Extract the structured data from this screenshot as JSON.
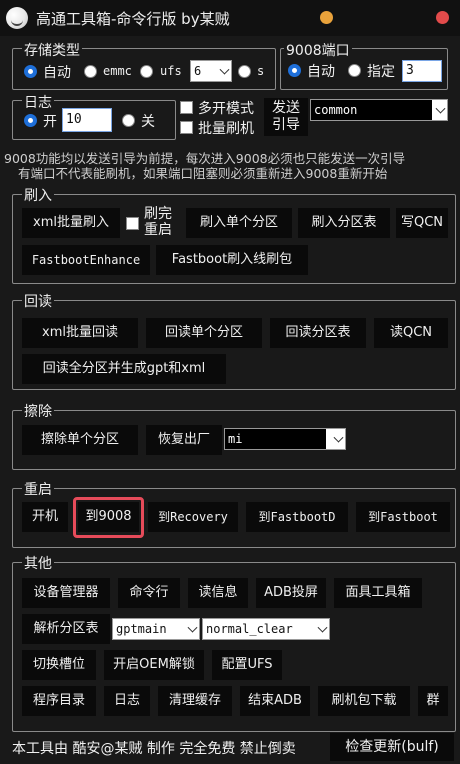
{
  "window": {
    "title": "高通工具箱-命令行版 by某贼"
  },
  "storage": {
    "label": "存储类型",
    "opt_auto": "自动",
    "opt_emmc": "emmc",
    "opt_ufs": "ufs",
    "lun_value": "6",
    "opt_s": "s"
  },
  "port9008": {
    "label": "9008端口",
    "opt_auto": "自动",
    "opt_specify": "指定",
    "value": "3"
  },
  "log": {
    "label": "日志",
    "opt_on": "开",
    "level": "10",
    "opt_off": "关"
  },
  "options": {
    "multi_mode": "多开模式",
    "batch_flash": "批量刷机"
  },
  "send_guide": {
    "label_line1": "发送",
    "label_line2": "引导",
    "select_value": "common"
  },
  "notice": {
    "line1": "9008功能均以发送引导为前提，每次进入9008必须也只能发送一次引导",
    "line2": "有端口不代表能刷机，如果端口阻塞则必须重新进入9008重新开始"
  },
  "flash": {
    "label": "刷入",
    "xml_batch": "xml批量刷入",
    "reboot_after_line1": "刷完",
    "reboot_after_line2": "重启",
    "single_partition": "刷入单个分区",
    "partition_table": "刷入分区表",
    "write_qcn": "写QCN",
    "fastboot_enhance": "FastbootEnhance",
    "fastboot_line": "Fastboot刷入线刷包"
  },
  "readback": {
    "label": "回读",
    "xml_batch": "xml批量回读",
    "single_partition": "回读单个分区",
    "partition_table": "回读分区表",
    "read_qcn": "读QCN",
    "all_gpt": "回读全分区并生成gpt和xml"
  },
  "erase": {
    "label": "擦除",
    "single_partition": "擦除单个分区",
    "factory_reset": "恢复出厂",
    "brand_value": "mi"
  },
  "reboot": {
    "label": "重启",
    "power_on": "开机",
    "to_9008": "到9008",
    "to_recovery": "到Recovery",
    "to_fastbootd": "到FastbootD",
    "to_fastboot": "到Fastboot"
  },
  "other": {
    "label": "其他",
    "device_manager": "设备管理器",
    "cmd": "命令行",
    "read_info": "读信息",
    "adb_screen": "ADB投屏",
    "mask_toolbox": "面具工具箱",
    "parse_partition": "解析分区表",
    "gpt_select": "gptmain",
    "mode_select": "normal_clear",
    "switch_slot": "切换槽位",
    "oem_unlock": "开启OEM解锁",
    "config_ufs": "配置UFS",
    "program_dir": "程序目录",
    "log": "日志",
    "clear_cache": "清理缓存",
    "kill_adb": "结束ADB",
    "rom_download": "刷机包下载",
    "group": "群"
  },
  "footer": {
    "credit": "本工具由 酷安@某贼 制作 完全免费 禁止倒卖",
    "check_update": "检查更新(bulf)"
  }
}
